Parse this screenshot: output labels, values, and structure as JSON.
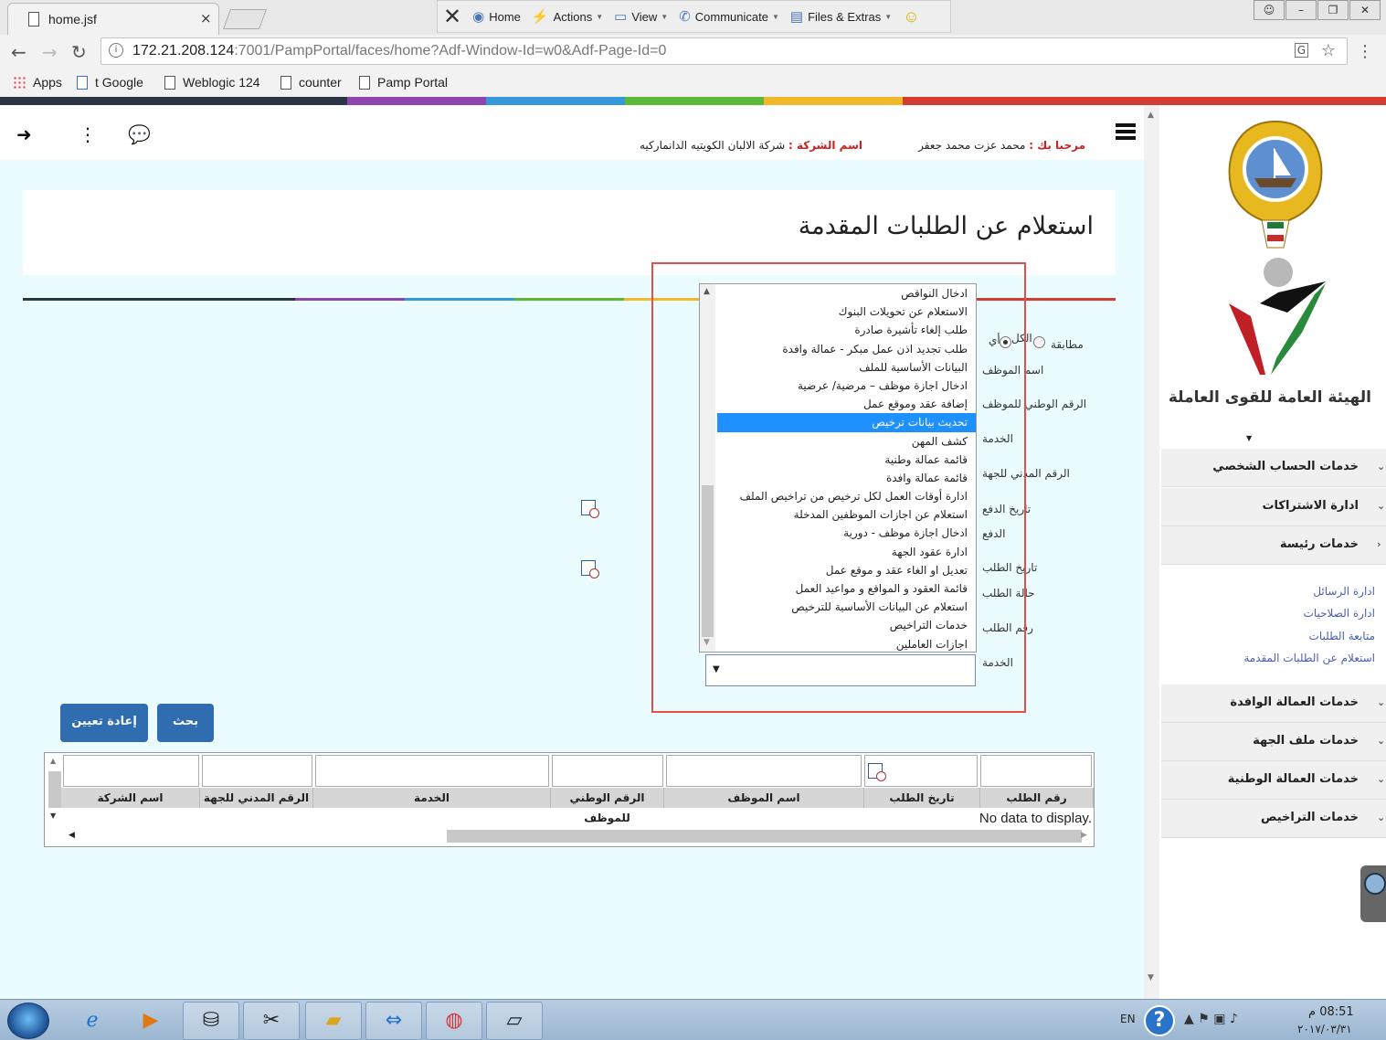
{
  "browser": {
    "tab_title": "home.jsf",
    "tab_close": "×",
    "toolbar": [
      "Home",
      "Actions",
      "View",
      "Communicate",
      "Files & Extras"
    ],
    "url_host": "172.21.208.124",
    "url_rest": ":7001/PampPortal/faces/home?Adf-Window-Id=w0&Adf-Page-Id=0",
    "bookmarks": [
      "Apps",
      "t Google",
      "Weblogic 124",
      "counter",
      "Pamp Portal"
    ]
  },
  "header": {
    "welcome_label": "مرحبا بك :",
    "user_name": "محمد عزت محمد جعفر",
    "company_label": "اسم الشركة :",
    "company_name": "شركة الالبان الكويتيه الدانماركيه"
  },
  "page_title": "استعلام عن الطلبات المقدمة",
  "form": {
    "match_label": "مطابقة",
    "match_all": "الكل",
    "match_any": "أي",
    "labels": [
      "اسم الموظف",
      "الرقم الوطني للموظف",
      "الخدمة",
      "الرقم المدني للجهة",
      "تاريخ الدفع",
      "الدفع",
      "تاريخ الطلب",
      "حالة الطلب",
      "رقم الطلب",
      "الخدمة"
    ]
  },
  "service_list": {
    "items": [
      "ادخال النواقص",
      "الاستعلام عن تحويلات البنوك",
      "طلب إلغاء تأشيرة صادرة",
      "طلب تجديد اذن عمل مبكر - عمالة وافدة",
      "البيانات الأساسية للملف",
      "ادخال اجازة موظف – مرضية/ عرضية",
      "إضافة عقد وموقع عمل",
      "تحديث بيانات ترخيص",
      "كشف المهن",
      "قائمة عمالة وطنية",
      "قائمة عمالة وافدة",
      "ادارة أوقات العمل لكل ترخيص من تراخيص الملف",
      "استعلام عن اجازات الموظفين المدخلة",
      "ادخال اجازة موظف - دورية",
      "ادارة عقود الجهة",
      "تعديل او الغاء عقد و موقع عمل",
      "قائمة العقود و المواقع و مواعيد العمل",
      "استعلام عن البيانات الأساسية للترخيص",
      "خدمات التراخيص",
      "اجازات العاملين"
    ],
    "selected": "تحديث بيانات ترخيص",
    "select_value": ""
  },
  "buttons": {
    "search": "بحث",
    "reset": "إعادة تعيين"
  },
  "results_table": {
    "columns": [
      "رقم الطلب",
      "تاريخ الطلب",
      "اسم الموظف",
      "الرقم الوطني للموظف",
      "الخدمة",
      "الرقم المدني للجهة",
      "اسم الشركة"
    ],
    "empty_text": "No data to display."
  },
  "sidebar": {
    "org_name": "الهيئة العامة للقوى العاملة",
    "sections_top": [
      "خدمات الحساب الشخصي",
      "ادارة الاشتراكات",
      "خدمات رئيسة"
    ],
    "sub_links": [
      "ادارة الرسائل",
      "ادارة الصلاحيات",
      "متابعة الطلبات",
      "استعلام عن الطلبات المقدمة"
    ],
    "sections_bottom": [
      "خدمات العمالة الوافدة",
      "خدمات ملف الجهة",
      "خدمات العمالة الوطنية",
      "خدمات التراخيص"
    ]
  },
  "taskbar": {
    "lang": "EN",
    "time": "08:51 م",
    "date": "٢٠١٧/٠٣/٣١"
  },
  "colors": {
    "highlight_border": "#e05050",
    "button_blue": "#2f6db0",
    "selected_item": "#1e90ff",
    "page_bg": "#eafcfd"
  }
}
